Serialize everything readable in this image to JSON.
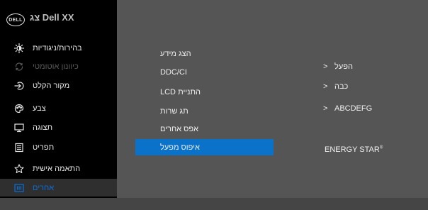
{
  "header": {
    "logo_text": "DELL",
    "title": "צג Dell XX"
  },
  "sidebar": {
    "items": [
      {
        "label": "בהירות/ניגודיות",
        "icon": "brightness-icon",
        "state": "normal"
      },
      {
        "label": "כיוונון אוטומטי",
        "icon": "auto-adjust-icon",
        "state": "disabled"
      },
      {
        "label": "מקור הקלט",
        "icon": "input-source-icon",
        "state": "normal"
      },
      {
        "label": "צבע",
        "icon": "color-icon",
        "state": "normal"
      },
      {
        "label": "תצוגה",
        "icon": "display-icon",
        "state": "normal"
      },
      {
        "label": "תפריט",
        "icon": "menu-icon",
        "state": "normal"
      },
      {
        "label": "התאמה אישית",
        "icon": "star-icon",
        "state": "normal"
      },
      {
        "label": "אחרים",
        "icon": "others-icon",
        "state": "active"
      }
    ]
  },
  "menu": {
    "items": [
      {
        "label": "הצג מידע"
      },
      {
        "label": "DDC/CI"
      },
      {
        "label": "LCD התניית"
      },
      {
        "label": "תג שרות"
      },
      {
        "label": "אפס אחרים"
      },
      {
        "label": "איפוס מפעל"
      }
    ],
    "selected_index": 5
  },
  "values": {
    "ddcci": "הפעל",
    "lcd": "כבה",
    "service_tag": "ABCDEFG",
    "chevron": ">"
  },
  "energy_star": {
    "label": "ENERGY STAR",
    "mark": "®"
  },
  "colors": {
    "accent": "#0a72c9",
    "active_text": "#0a6fd6",
    "panel": "#555555",
    "sidebar": "#000000"
  }
}
